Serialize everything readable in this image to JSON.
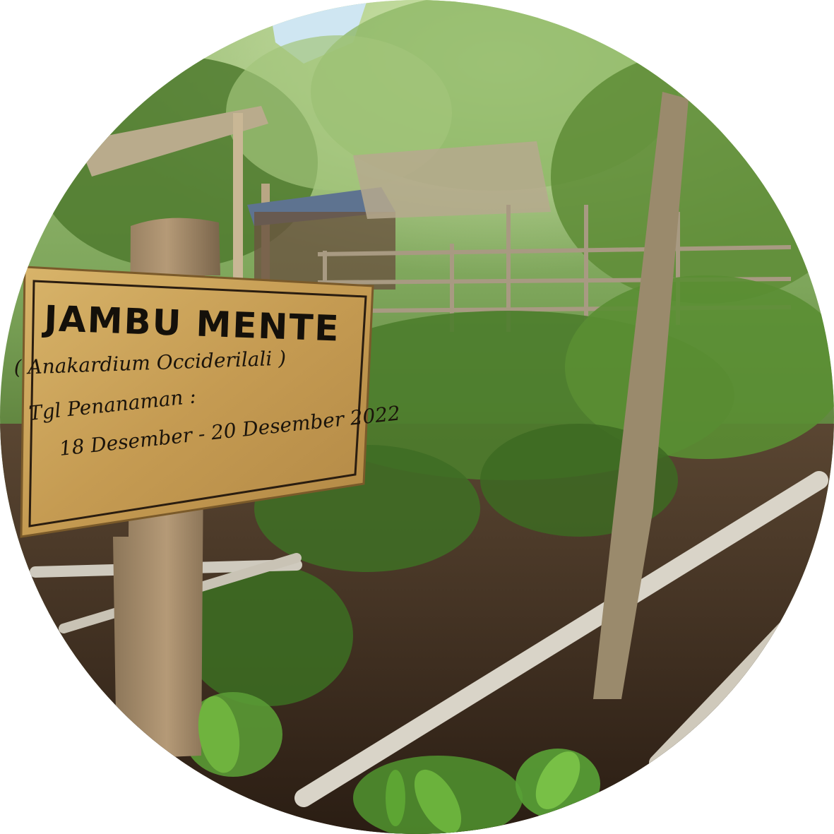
{
  "photo": {
    "shape": "circle",
    "subject": "garden-sign"
  },
  "sign": {
    "title": "JAMBU MENTE",
    "latin_name": "( Anakardium Occiderilali )",
    "planting_label": "Tgl Penanaman :",
    "planting_dates": "18 Desember - 20 Desember 2022"
  },
  "colors": {
    "sign_wood": "#c9a25a",
    "foliage": "#4f7a2e",
    "soil": "#3a2a1c",
    "sky": "#cfe6f2"
  }
}
